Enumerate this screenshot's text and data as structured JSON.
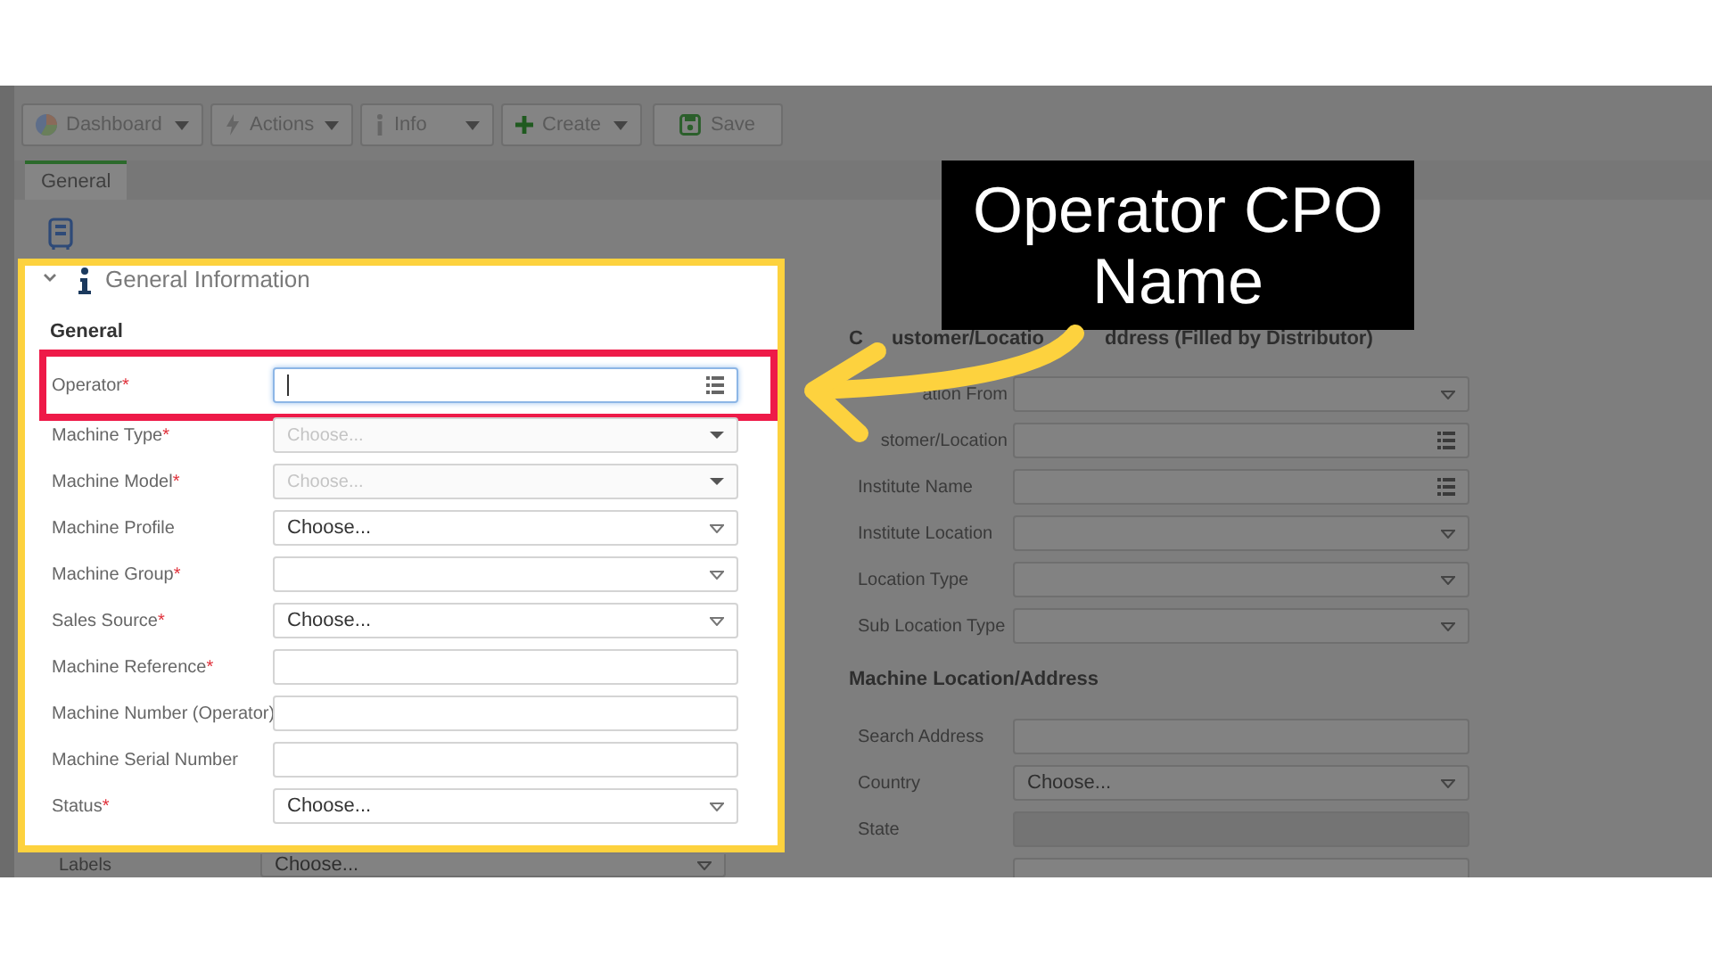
{
  "toolbar": [
    {
      "label": "Dashboard",
      "caret": true
    },
    {
      "label": "Actions",
      "caret": true
    },
    {
      "label": "Info",
      "caret": true
    },
    {
      "label": "Create",
      "caret": true
    },
    {
      "label": "Save",
      "caret": false
    }
  ],
  "tabs": [
    {
      "label": "General",
      "selected": true
    }
  ],
  "section": {
    "title": "General Information",
    "expanded": true
  },
  "group_title": "General",
  "fields": [
    {
      "label": "Operator",
      "mark": "*",
      "kind": "lookup",
      "focused": true,
      "highlighted": true
    },
    {
      "label": "Machine Type",
      "mark": "*",
      "kind": "select",
      "placeholder": "Choose...",
      "disabled": true
    },
    {
      "label": "Machine Model",
      "mark": "*",
      "kind": "select",
      "placeholder": "Choose...",
      "disabled": true
    },
    {
      "label": "Machine Profile",
      "kind": "select",
      "value": "Choose..."
    },
    {
      "label": "Machine Group",
      "mark": "*",
      "kind": "select"
    },
    {
      "label": "Sales Source",
      "mark": "*",
      "kind": "select",
      "value": "Choose..."
    },
    {
      "label": "Machine Reference",
      "mark": "*",
      "kind": "text"
    },
    {
      "label": "Machine Number (Operator)",
      "kind": "text"
    },
    {
      "label": "Machine Serial Number",
      "kind": "text"
    },
    {
      "label": "Status",
      "mark": "*",
      "kind": "select",
      "value": "Choose..."
    }
  ],
  "below_fields": [
    {
      "label": "Labels",
      "kind": "select",
      "value": "Choose..."
    }
  ],
  "right_sections": [
    {
      "title_parts": [
        "C",
        "ustomer/Locatio",
        "ddress (Filled by Distributor)"
      ],
      "fields": [
        {
          "label": "ation From",
          "kind": "select",
          "partly_hidden": true
        },
        {
          "label": "stomer/Location",
          "kind": "lookup",
          "partly_hidden": true
        },
        {
          "label": "Institute Name",
          "kind": "lookup"
        },
        {
          "label": "Institute Location",
          "kind": "select"
        },
        {
          "label": "Location Type",
          "kind": "select"
        },
        {
          "label": "Sub Location Type",
          "kind": "select"
        }
      ]
    },
    {
      "title_parts": [
        "Machine Location/Address"
      ],
      "fields": [
        {
          "label": "Search Address",
          "kind": "text"
        },
        {
          "label": "Country",
          "kind": "select",
          "value": "Choose..."
        },
        {
          "label": "State",
          "kind": "text",
          "disabled": true
        }
      ]
    }
  ],
  "callout": {
    "text": "Operator CPO Name"
  }
}
